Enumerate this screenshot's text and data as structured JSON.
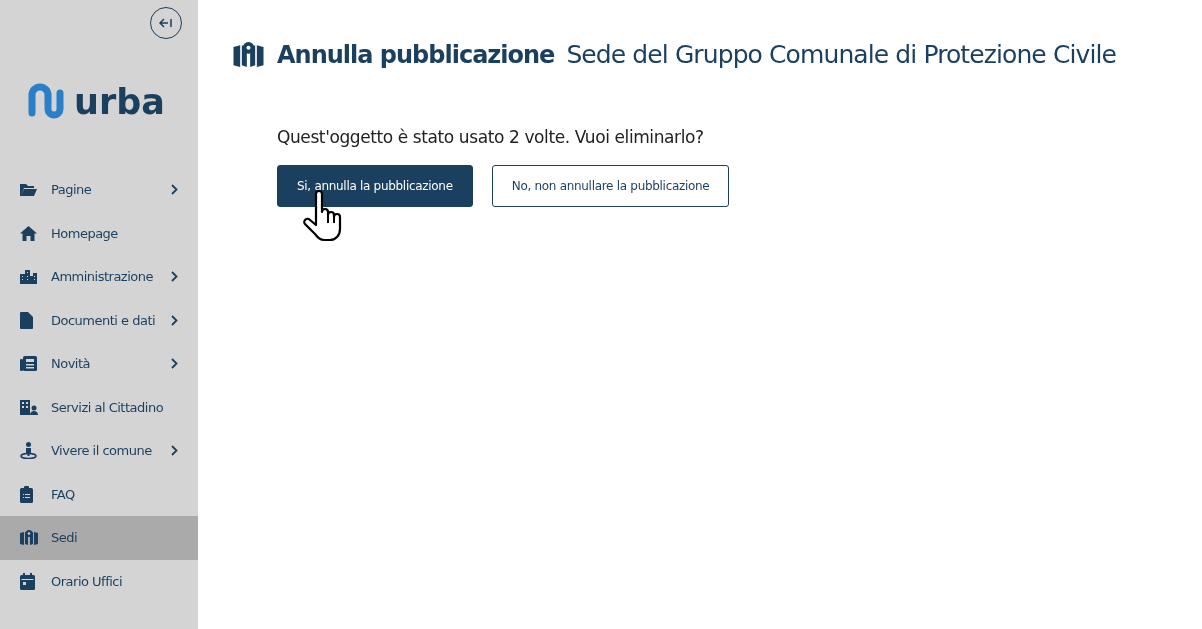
{
  "sidebar": {
    "logo": "urba",
    "items": [
      {
        "label": "Pagine",
        "has_submenu": true,
        "selected": false
      },
      {
        "label": "Homepage",
        "has_submenu": false,
        "selected": false
      },
      {
        "label": "Amministrazione",
        "has_submenu": true,
        "selected": false
      },
      {
        "label": "Documenti e dati",
        "has_submenu": true,
        "selected": false
      },
      {
        "label": "Novità",
        "has_submenu": true,
        "selected": false
      },
      {
        "label": "Servizi al Cittadino",
        "has_submenu": false,
        "selected": false
      },
      {
        "label": "Vivere il comune",
        "has_submenu": true,
        "selected": false
      },
      {
        "label": "FAQ",
        "has_submenu": false,
        "selected": false
      },
      {
        "label": "Sedi",
        "has_submenu": false,
        "selected": true
      },
      {
        "label": "Orario Uffici",
        "has_submenu": false,
        "selected": false
      }
    ]
  },
  "header": {
    "title": "Annulla pubblicazione",
    "subtitle": "Sede del Gruppo Comunale di Protezione Civile"
  },
  "question": "Quest'oggetto è stato usato 2 volte. Vuoi eliminarlo?",
  "buttons": [
    {
      "label": "Si, annulla la pubblicazione",
      "kind": "primary"
    },
    {
      "label": "No, non annullare la pubblicazione",
      "kind": "secondary"
    }
  ]
}
